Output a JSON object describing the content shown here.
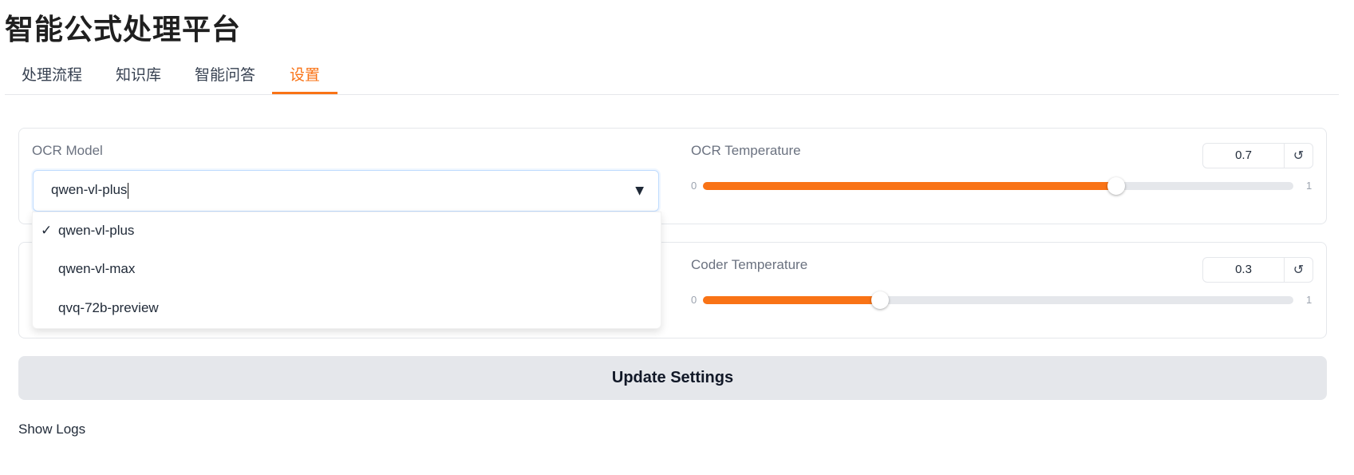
{
  "app": {
    "title": "智能公式处理平台"
  },
  "tabs": [
    {
      "label": "处理流程",
      "active": false
    },
    {
      "label": "知识库",
      "active": false
    },
    {
      "label": "智能问答",
      "active": false
    },
    {
      "label": "设置",
      "active": true
    }
  ],
  "ocr": {
    "model_label": "OCR Model",
    "model_value": "qwen-vl-plus",
    "temperature_label": "OCR Temperature",
    "temperature_value": "0.7",
    "temperature": 0.7,
    "min": "0",
    "max": "1"
  },
  "coder": {
    "temperature_label": "Coder Temperature",
    "temperature_value": "0.3",
    "temperature": 0.3,
    "min": "0",
    "max": "1"
  },
  "dropdown": {
    "check_mark": "✓",
    "options": [
      "qwen-vl-plus",
      "qwen-vl-max",
      "qvq-72b-preview"
    ]
  },
  "reset_icon": "↺",
  "caret_icon": "▼",
  "update_button": "Update Settings",
  "show_logs": "Show Logs",
  "colors": {
    "accent": "#f97316",
    "button_bg": "#e5e7eb"
  }
}
